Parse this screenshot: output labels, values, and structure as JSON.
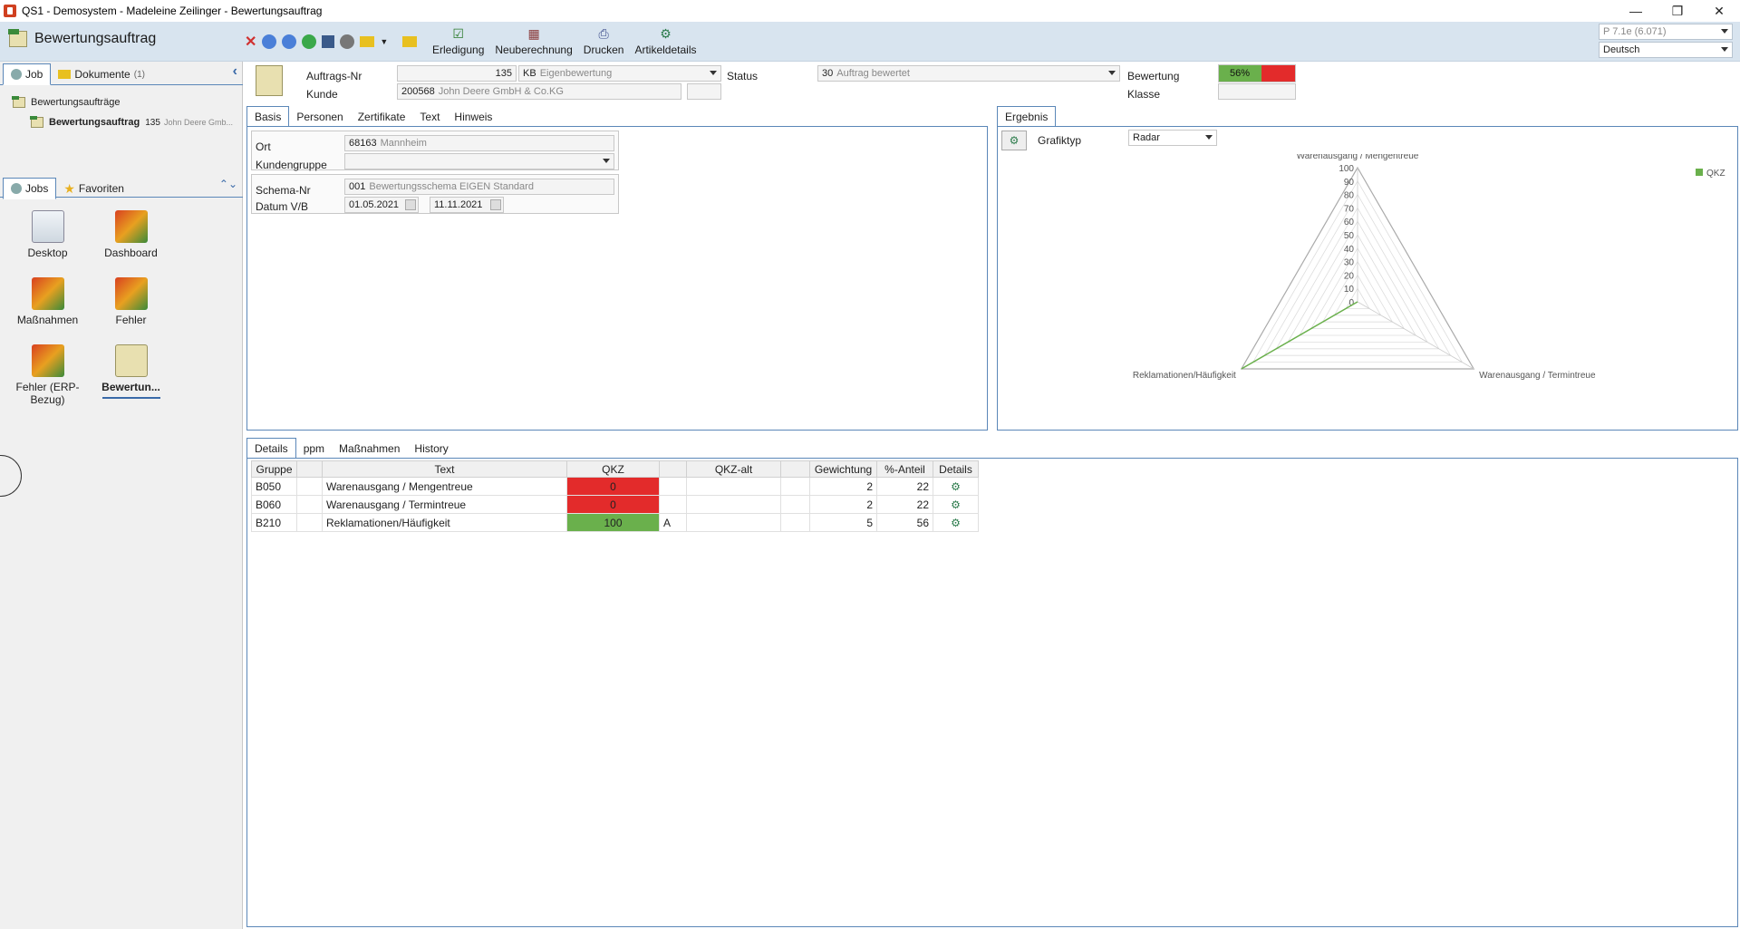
{
  "window": {
    "title": "QS1 - Demosystem - Madeleine Zeilinger - Bewertungsauftrag"
  },
  "toolbar": {
    "module_title": "Bewertungsauftrag",
    "buttons": [
      {
        "label": "Erledigung",
        "icon": "check-icon"
      },
      {
        "label": "Neuberechnung",
        "icon": "calculator-icon"
      },
      {
        "label": "Drucken",
        "icon": "printer-icon"
      },
      {
        "label": "Artikeldetails",
        "icon": "tool-icon"
      }
    ],
    "version": "P 7.1e (6.071)",
    "language": "Deutsch"
  },
  "left": {
    "tabs": [
      {
        "label": "Job"
      },
      {
        "label": "Dokumente",
        "count": "(1)"
      }
    ],
    "tree": {
      "root": "Bewertungsaufträge",
      "child_label": "Bewertungsauftrag",
      "child_num": "135",
      "child_sub": "John Deere Gmb..."
    },
    "job_tabs": [
      {
        "label": "Jobs"
      },
      {
        "label": "Favoriten"
      }
    ],
    "jobs": [
      {
        "label": "Desktop"
      },
      {
        "label": "Dashboard"
      },
      {
        "label": "Maßnahmen"
      },
      {
        "label": "Fehler"
      },
      {
        "label": "Fehler (ERP-Bezug)"
      },
      {
        "label": "Bewertun..."
      }
    ]
  },
  "header": {
    "auftrag_label": "Auftrags-Nr",
    "auftrag_value": "135",
    "kb_code": "KB",
    "kb_text": "Eigenbewertung",
    "status_label": "Status",
    "status_code": "30",
    "status_text": "Auftrag bewertet",
    "bewertung_label": "Bewertung",
    "bewertung_value": "56%",
    "bewertung_fraction": 0.56,
    "kunde_label": "Kunde",
    "kunde_num": "200568",
    "kunde_name": "John Deere GmbH & Co.KG",
    "klasse_label": "Klasse"
  },
  "basis": {
    "tabs": [
      "Basis",
      "Personen",
      "Zertifikate",
      "Text",
      "Hinweis"
    ],
    "ort_label": "Ort",
    "ort_plz": "68163",
    "ort_name": "Mannheim",
    "kundengruppe_label": "Kundengruppe",
    "schema_label": "Schema-Nr",
    "schema_num": "001",
    "schema_text": "Bewertungsschema EIGEN Standard",
    "datum_label": "Datum V/B",
    "datum_von": "01.05.2021",
    "datum_bis": "11.11.2021"
  },
  "ergebnis": {
    "tab": "Ergebnis",
    "grafiktyp_label": "Grafiktyp",
    "grafiktyp_value": "Radar"
  },
  "chart_data": {
    "type": "radar",
    "axes": [
      "Warenausgang / Mengentreue",
      "Warenausgang / Termintreue",
      "Reklamationen/Häufigkeit"
    ],
    "ticks": [
      "100",
      "90",
      "80",
      "70",
      "60",
      "50",
      "40",
      "30",
      "20",
      "10",
      "0"
    ],
    "range": [
      0,
      100
    ],
    "series": [
      {
        "name": "QKZ",
        "values": [
          0,
          0,
          100
        ],
        "color": "#6ab04c"
      }
    ],
    "legend": "top-right"
  },
  "details": {
    "tabs": [
      "Details",
      "ppm",
      "Maßnahmen",
      "History"
    ],
    "columns": [
      "Gruppe",
      "",
      "Text",
      "QKZ",
      "",
      "QKZ-alt",
      "",
      "Gewichtung",
      "%-Anteil",
      "Details"
    ],
    "rows": [
      {
        "gruppe": "B050",
        "text": "Warenausgang / Mengentreue",
        "qkz": "0",
        "flag": "",
        "qkz_alt": "",
        "gewichtung": "2",
        "anteil": "22",
        "qkz_color": "#e32b2b"
      },
      {
        "gruppe": "B060",
        "text": "Warenausgang / Termintreue",
        "qkz": "0",
        "flag": "",
        "qkz_alt": "",
        "gewichtung": "2",
        "anteil": "22",
        "qkz_color": "#e32b2b"
      },
      {
        "gruppe": "B210",
        "text": "Reklamationen/Häufigkeit",
        "qkz": "100",
        "flag": "A",
        "qkz_alt": "",
        "gewichtung": "5",
        "anteil": "56",
        "qkz_color": "#6ab04c"
      }
    ]
  },
  "colors": {
    "accent": "#5b87b8",
    "red": "#e32b2b",
    "green": "#6ab04c",
    "toolbar_bg": "#d8e4ef"
  }
}
